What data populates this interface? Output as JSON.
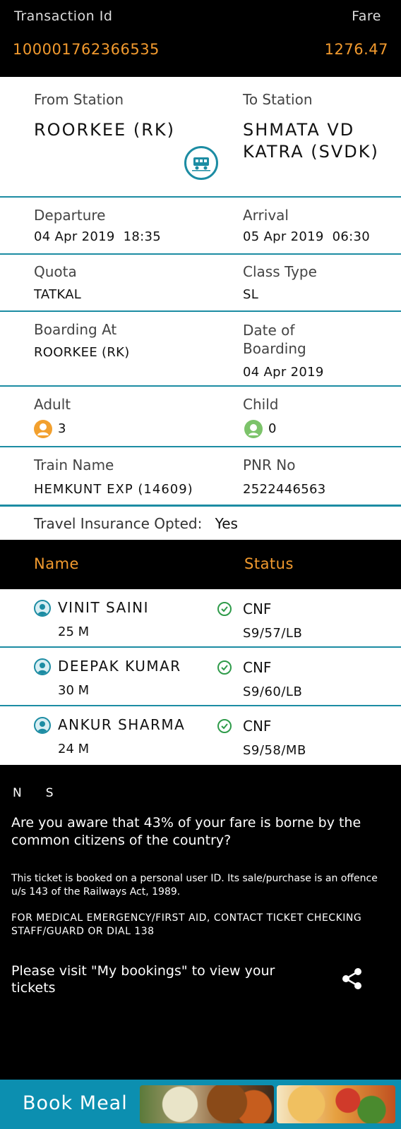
{
  "header": {
    "transaction_label": "Transaction Id",
    "fare_label": "Fare",
    "transaction_id": "100001762366535",
    "fare": "1276.47"
  },
  "journey": {
    "from_label": "From Station",
    "from_value": "ROORKEE (RK)",
    "to_label": "To Station",
    "to_value": "SHMATA VD KATRA (SVDK)",
    "departure_label": "Departure",
    "departure_value": "04 Apr 2019  18:35",
    "arrival_label": "Arrival",
    "arrival_value": "05 Apr 2019  06:30",
    "quota_label": "Quota",
    "quota_value": "TATKAL",
    "class_label": "Class Type",
    "class_value": "SL",
    "boarding_label": "Boarding At",
    "boarding_value": "ROORKEE (RK)",
    "date_boarding_label": "Date of Boarding",
    "date_boarding_value": "04 Apr 2019",
    "adult_label": "Adult",
    "adult_count": "3",
    "child_label": "Child",
    "child_count": "0",
    "train_label": "Train Name",
    "train_value": "HEMKUNT EXP (14609)",
    "pnr_label": "PNR No",
    "pnr_value": "2522446563",
    "insurance_label": "Travel Insurance Opted:",
    "insurance_value": "Yes"
  },
  "passenger_header": {
    "name": "Name",
    "status": "Status"
  },
  "passengers": [
    {
      "name": "VINIT SAINI",
      "info": "25 M",
      "status": "CNF",
      "berth": "S9/57/LB"
    },
    {
      "name": "DEEPAK KUMAR",
      "info": "30 M",
      "status": "CNF",
      "berth": "S9/60/LB"
    },
    {
      "name": "ANKUR SHARMA",
      "info": "24 M",
      "status": "CNF",
      "berth": "S9/58/MB"
    }
  ],
  "notice": {
    "n": "N",
    "s": "S",
    "aware": "Are you aware that 43% of your fare is borne by the common citizens of the country?",
    "personal": "This ticket is booked on a personal user ID. Its sale/purchase is an offence u/s 143 of the Railways Act, 1989.",
    "medical": "FOR MEDICAL EMERGENCY/FIRST AID, CONTACT TICKET CHECKING STAFF/GUARD OR DIAL 138",
    "visit": "Please visit \"My bookings\" to view your tickets"
  },
  "footer": {
    "book_meal": "Book Meal"
  },
  "icons": {
    "train": "train-icon",
    "adult": "adult-icon",
    "child": "child-icon",
    "user": "user-icon",
    "check": "check-circle-icon",
    "share": "share-icon"
  },
  "colors": {
    "accent": "#f29a2e",
    "teal": "#1c8ca3",
    "meal_bar": "#0c8fb0"
  }
}
